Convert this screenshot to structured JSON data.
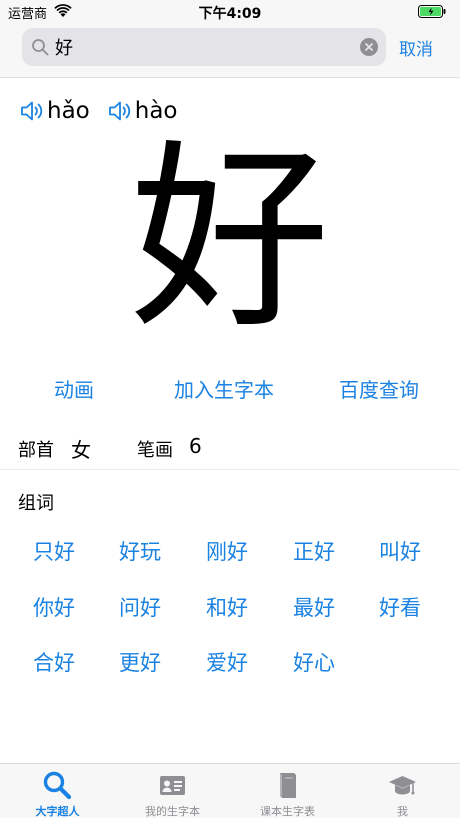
{
  "status_bar": {
    "carrier": "运营商",
    "time": "下午4:09"
  },
  "search": {
    "value": "好",
    "cancel_label": "取消"
  },
  "pronunciations": [
    {
      "pinyin": "hǎo"
    },
    {
      "pinyin": "hào"
    }
  ],
  "character": "好",
  "actions": {
    "animation": "动画",
    "add_to_list": "加入生字本",
    "baidu": "百度查询"
  },
  "info": {
    "radical_label": "部首",
    "radical_value": "女",
    "strokes_label": "笔画",
    "strokes_value": "6"
  },
  "words": {
    "title": "组词",
    "items": [
      "只好",
      "好玩",
      "刚好",
      "正好",
      "叫好",
      "你好",
      "问好",
      "和好",
      "最好",
      "好看",
      "合好",
      "更好",
      "爱好",
      "好心"
    ]
  },
  "tabs": [
    {
      "label": "大字超人",
      "icon": "search-icon",
      "active": true
    },
    {
      "label": "我的生字本",
      "icon": "id-card-icon",
      "active": false
    },
    {
      "label": "课本生字表",
      "icon": "book-icon",
      "active": false
    },
    {
      "label": "我",
      "icon": "graduation-cap-icon",
      "active": false
    }
  ],
  "colors": {
    "accent": "#1a82e2",
    "inactive_tab": "#8e8e93",
    "battery": "#4cd964"
  }
}
